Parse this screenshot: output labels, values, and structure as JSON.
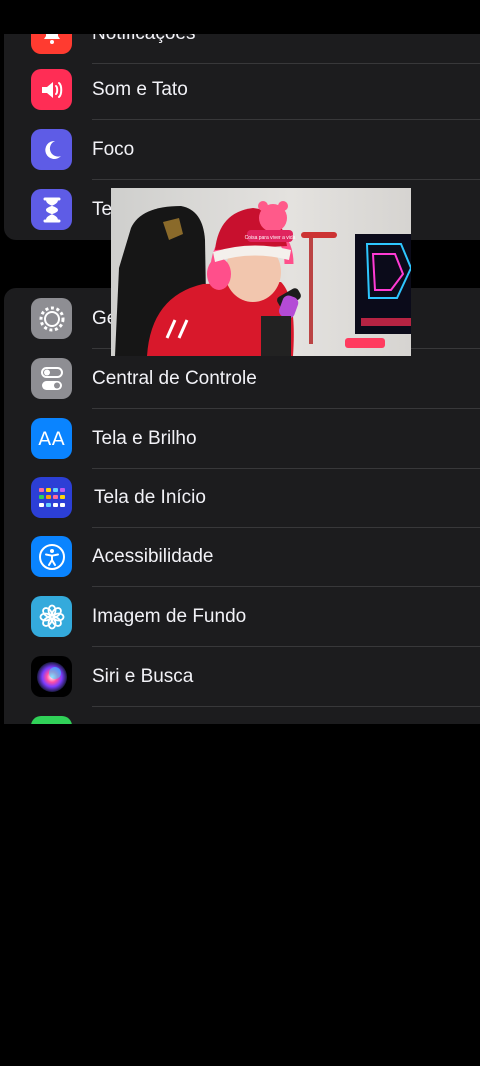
{
  "settings_group_1": {
    "items": [
      {
        "label": "Notificações",
        "icon": "bell-icon",
        "color": "#ff3b30"
      },
      {
        "label": "Som e Tato",
        "icon": "speaker-icon",
        "color": "#ff2d55"
      },
      {
        "label": "Foco",
        "icon": "moon-icon",
        "color": "#5e5ce6"
      },
      {
        "label": "Te",
        "icon": "hourglass-icon",
        "color": "#5e5ce6"
      }
    ]
  },
  "settings_group_2": {
    "items": [
      {
        "label": "Ge",
        "icon": "gear-icon",
        "color": "#8e8e93"
      },
      {
        "label": "Central de Controle",
        "icon": "toggles-icon",
        "color": "#8e8e93"
      },
      {
        "label": "Tela e Brilho",
        "icon": "text-size-icon",
        "color": "#0a84ff"
      },
      {
        "label": "Tela de Início",
        "icon": "app-grid-icon",
        "color": "#2c3fd6"
      },
      {
        "label": "Acessibilidade",
        "icon": "accessibility-icon",
        "color": "#0a84ff"
      },
      {
        "label": "Imagem de Fundo",
        "icon": "flower-icon",
        "color": "#34aadc"
      },
      {
        "label": "Siri e Busca",
        "icon": "siri-icon",
        "color": "#000000"
      },
      {
        "label": "",
        "icon": "green-app-icon",
        "color": "#30d158"
      }
    ]
  },
  "icon_glyphs": {
    "text_size": "AA"
  },
  "pip_overlay": {
    "hat_text": "Coisa para viver a vida"
  }
}
